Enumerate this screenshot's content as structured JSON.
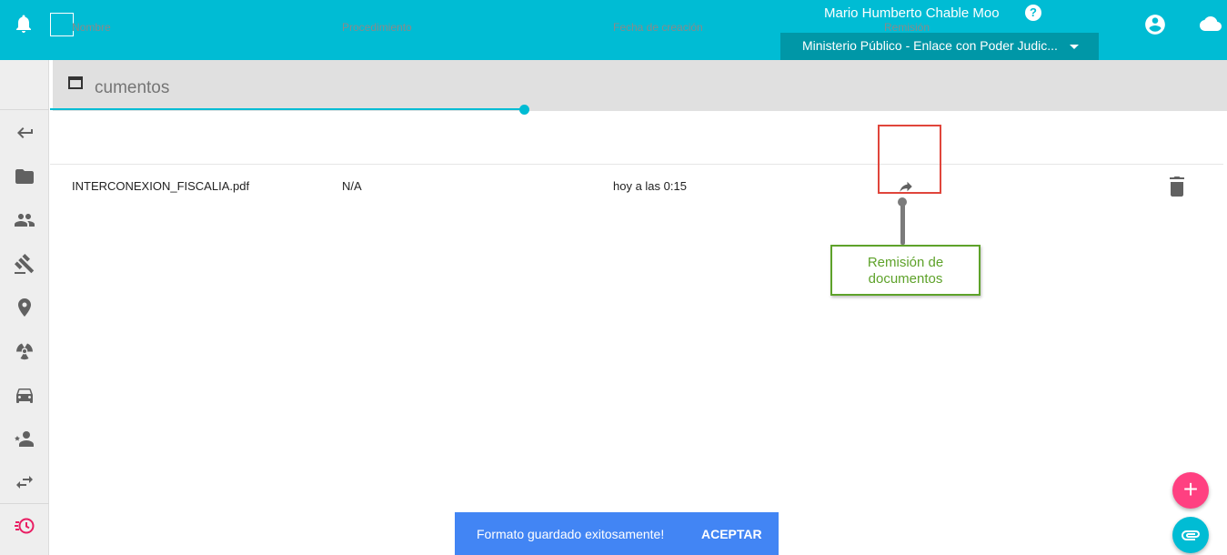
{
  "header": {
    "user_name": "Mario Humberto Chable Moo",
    "help_label": "?",
    "role_selector": "Ministerio Público - Enlace con Poder Judic..."
  },
  "sidebar": {
    "items": [
      {
        "icon": "back-arrow-icon"
      },
      {
        "icon": "folder-icon"
      },
      {
        "icon": "people-icon"
      },
      {
        "icon": "gavel-icon"
      },
      {
        "icon": "location-pin-icon"
      },
      {
        "icon": "radioactive-icon"
      },
      {
        "icon": "car-icon"
      },
      {
        "icon": "person-star-icon"
      },
      {
        "icon": "swap-arrows-icon"
      },
      {
        "icon": "history-icon",
        "active": true
      }
    ]
  },
  "panel": {
    "title": "cumentos"
  },
  "table": {
    "columns": [
      "Nombre",
      "Procedimiento",
      "Fecha de creación",
      "Remisión"
    ],
    "rows": [
      {
        "nombre": "INTERCONEXION_FISCALIA.pdf",
        "procedimiento": "N/A",
        "fecha": "hoy a las 0:15"
      }
    ]
  },
  "callout": {
    "text_line1": "Remisión de",
    "text_line2": "documentos"
  },
  "snackbar": {
    "message": "Formato guardado exitosamente!",
    "action": "ACEPTAR"
  },
  "fab": {
    "add_label": "+"
  },
  "colors": {
    "primary": "#00bcd4",
    "primary_dark": "#0097a7",
    "accent": "#ff4081",
    "snackbar": "#4285f4",
    "callout_red": "#e0453b",
    "callout_green": "#5ea22a"
  }
}
